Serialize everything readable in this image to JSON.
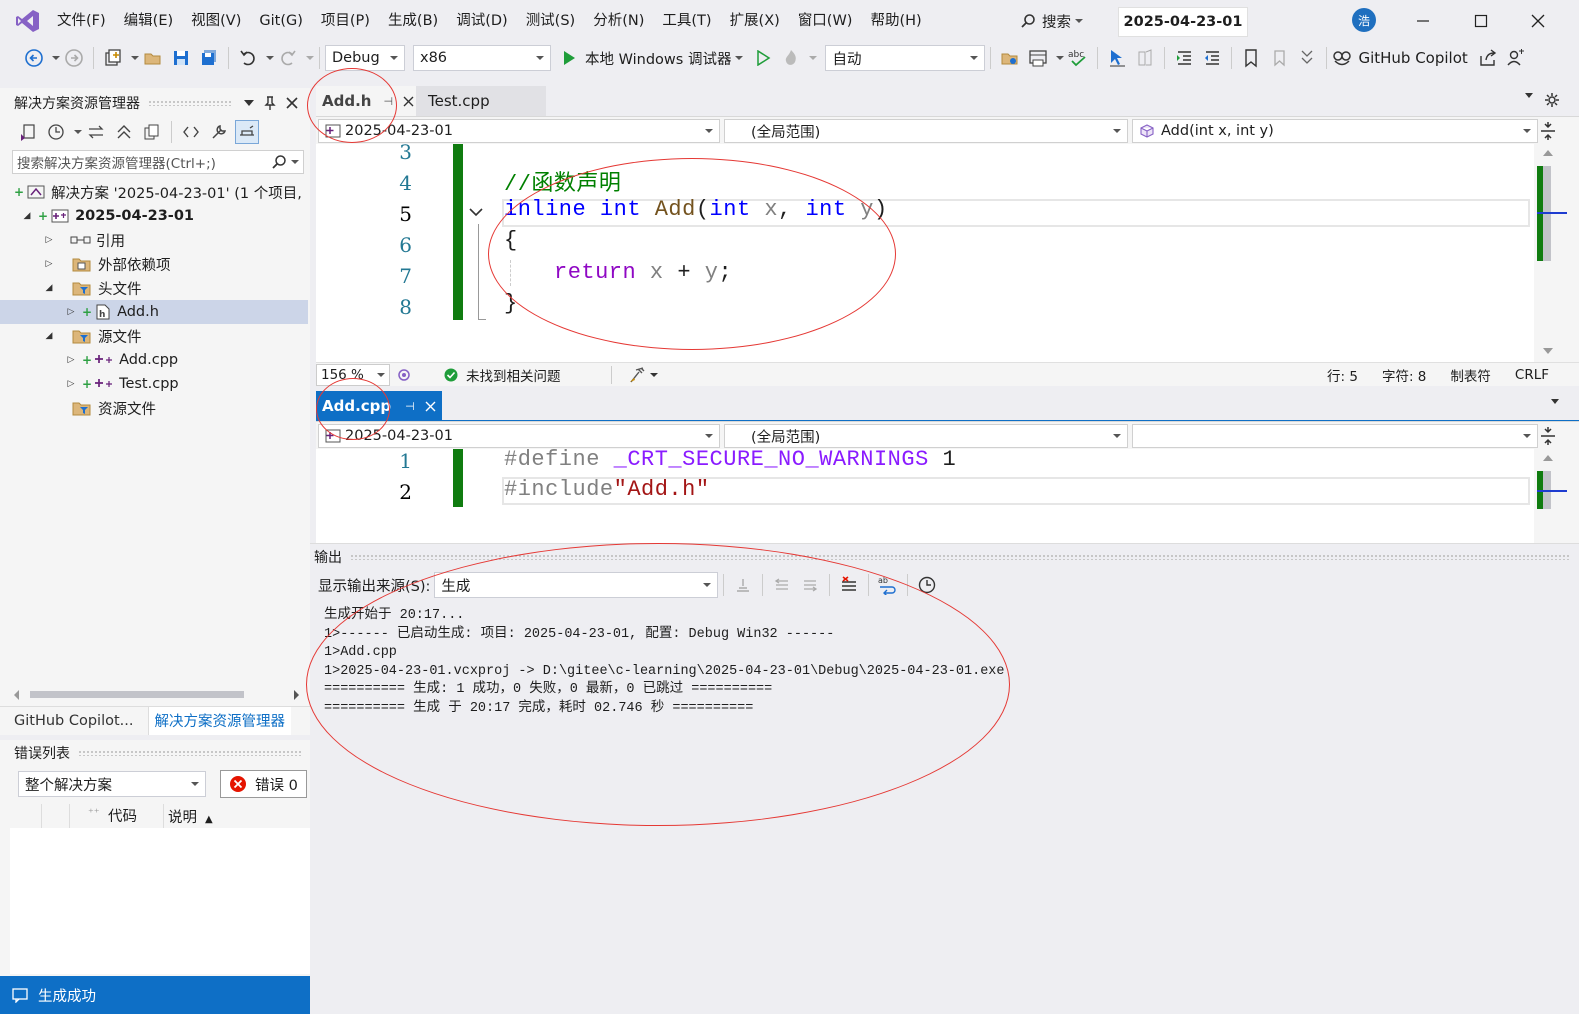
{
  "menu": [
    "文件(F)",
    "编辑(E)",
    "视图(V)",
    "Git(G)",
    "项目(P)",
    "生成(B)",
    "调试(D)",
    "测试(S)",
    "分析(N)",
    "工具(T)",
    "扩展(X)",
    "窗口(W)",
    "帮助(H)"
  ],
  "search_label": "搜索",
  "solution_title": "2025-04-23-01",
  "user_initial": "浩",
  "toolbar": {
    "config": "Debug",
    "platform": "x86",
    "run_label": "本地 Windows 调试器",
    "auto": "自动",
    "copilot": "GitHub Copilot"
  },
  "solution_explorer": {
    "title": "解决方案资源管理器",
    "search_placeholder": "搜索解决方案资源管理器(Ctrl+;)",
    "solution_node": "解决方案 '2025-04-23-01' (1 个项目,",
    "project_node": "2025-04-23-01",
    "items": [
      "引用",
      "外部依赖项",
      "头文件",
      "Add.h",
      "源文件",
      "Add.cpp",
      "Test.cpp",
      "资源文件"
    ]
  },
  "bottom_tabs": [
    "GitHub Copilot...",
    "解决方案资源管理器"
  ],
  "error_list": {
    "title": "错误列表",
    "scope": "整个解决方案",
    "errors_label": "错误 0",
    "col_code": "代码",
    "col_desc": "说明"
  },
  "status": "生成成功",
  "editor1": {
    "tabs": [
      "Add.h",
      "Test.cpp"
    ],
    "nav": [
      "2025-04-23-01",
      "(全局范围)",
      "Add(int x, int y)"
    ],
    "line_numbers": [
      "3",
      "4",
      "5",
      "6",
      "7",
      "8"
    ],
    "lines": {
      "l4": "//函数声明",
      "l5_kw": "inline",
      "l5_ty": "int",
      "l5_fn": "Add",
      "l5_open": "(",
      "l5_ty2": "int",
      "l5_p1": "x",
      "l5_comma": ",",
      "l5_ty3": "int",
      "l5_p2": "y",
      "l5_close": ")",
      "l6": "{",
      "l7_kw": "return",
      "l7_a": "x",
      "l7_op": "+",
      "l7_b": "y",
      "l7_end": ";",
      "l8": "}"
    },
    "zoom": "156 %",
    "issues": "未找到相关问题",
    "row": "行: 5",
    "col": "字符: 8",
    "tab": "制表符",
    "eol": "CRLF"
  },
  "editor2": {
    "tab": "Add.cpp",
    "nav": [
      "2025-04-23-01",
      "(全局范围)"
    ],
    "line_numbers": [
      "1",
      "2"
    ],
    "lines": {
      "l1_pp": "#define",
      "l1_mac": "_CRT_SECURE_NO_WARNINGS",
      "l1_val": "1",
      "l2_pp": "#include",
      "l2_str": "\"Add.h\""
    }
  },
  "output": {
    "title": "输出",
    "source_label": "显示输出来源(S):",
    "source_value": "生成",
    "lines": [
      "生成开始于 20:17...",
      "1>------ 已启动生成: 项目: 2025-04-23-01, 配置: Debug Win32 ------",
      "1>Add.cpp",
      "1>2025-04-23-01.vcxproj -> D:\\gitee\\c-learning\\2025-04-23-01\\Debug\\2025-04-23-01.exe",
      "========== 生成: 1 成功，0 失败，0 最新，0 已跳过 ==========",
      "========== 生成 于 20:17 完成，耗时 02.746 秒 =========="
    ]
  },
  "colors": {
    "accent": "#0e6fc6",
    "vs_purple": "#68217a",
    "annotation": "#e53935",
    "gutter_green": "#107c10"
  }
}
